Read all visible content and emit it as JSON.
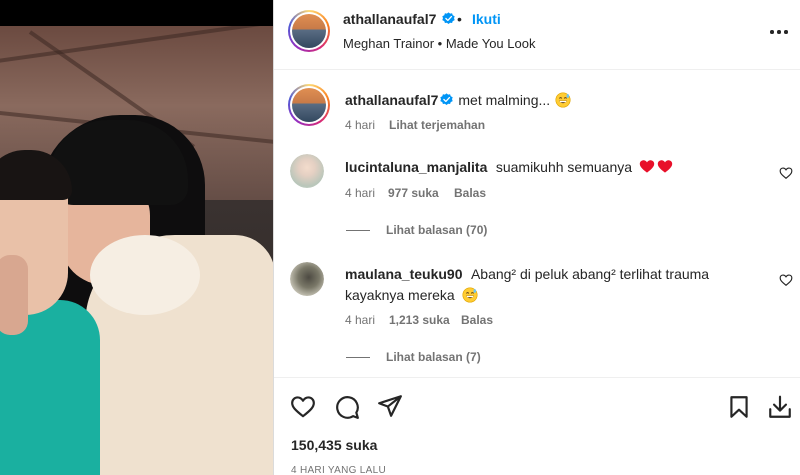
{
  "post": {
    "author": "athallanaufal7",
    "verified": true,
    "separator": "•",
    "follow_label": "Ikuti",
    "audio": "Meghan Trainor • Made You Look",
    "more_icon": "more-options-icon"
  },
  "caption": {
    "username": "athallanaufal7",
    "text": "met malming...",
    "emoji": "grinning-sweat-emoji",
    "time": "4 hari",
    "translate_label": "Lihat terjemahan"
  },
  "comments": [
    {
      "username": "lucintaluna_manjalita",
      "text": "suamikuhh semuanya",
      "emoji": "red-heart-emoji x2",
      "time": "4 hari",
      "likes": "977 suka",
      "reply_label": "Balas",
      "view_replies": "Lihat balasan (70)"
    },
    {
      "username": "maulana_teuku90",
      "text_line1": "Abang² di peluk abang² terlihat trauma",
      "text_line2": "kayaknya mereka",
      "emoji": "grinning-sweat-emoji",
      "time": "4 hari",
      "likes": "1,213 suka",
      "reply_label": "Balas",
      "view_replies": "Lihat balasan (7)"
    }
  ],
  "actions": {
    "icons": [
      "like-icon",
      "comment-icon",
      "share-icon",
      "save-icon",
      "download-icon"
    ],
    "likes": "150,435 suka",
    "timestamp": "4 HARI YANG LALU"
  },
  "colors": {
    "link_blue": "#0095f6",
    "verified_blue": "#0095f6",
    "heart_red": "#ed1c24",
    "muted": "#737373"
  }
}
